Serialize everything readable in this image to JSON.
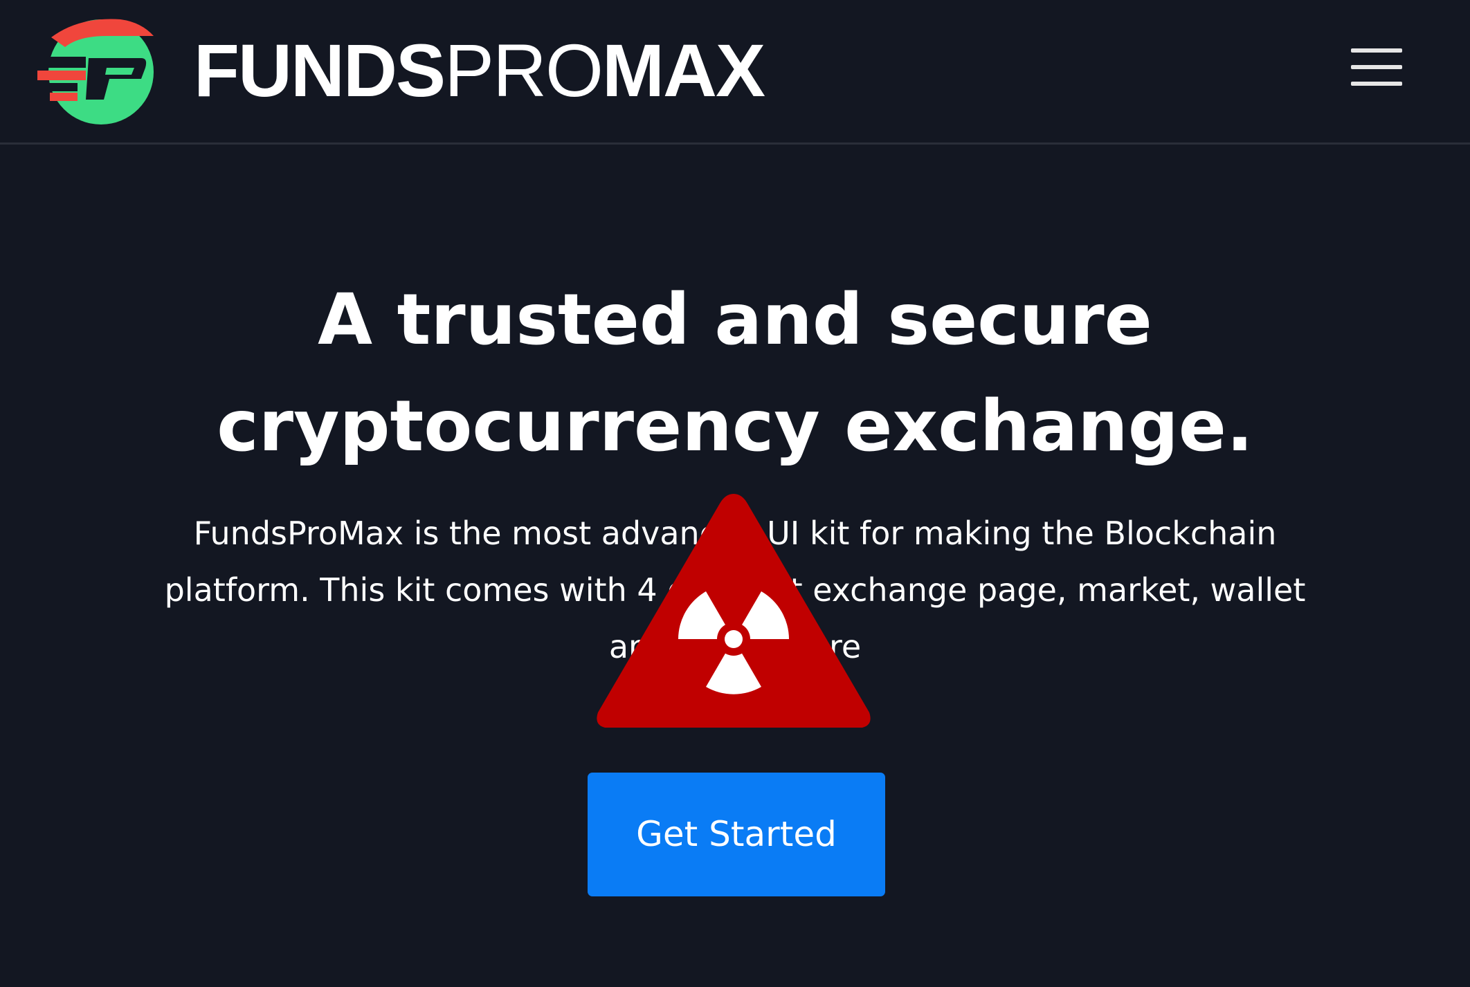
{
  "header": {
    "brand_bold_1": "FUNDS",
    "brand_light": "PRO",
    "brand_bold_2": "MAX",
    "logo_icon": "fundspromax-logo-icon",
    "menu_icon": "hamburger-menu-icon"
  },
  "hero": {
    "headline_lines": [
      "A trusted and secure",
      "cryptocurrency exchange."
    ],
    "lead_lines": [
      "FundsProMax is the most advanced UI kit for making the Blockchain",
      "platform. This kit comes with 4 different exchange page, market, wallet",
      "and many more"
    ],
    "cta_label": "Get Started",
    "overlay_icon": "radiation-warning-icon"
  },
  "colors": {
    "background": "#131722",
    "accent_blue": "#0a7cf5",
    "logo_green": "#3ddc84",
    "logo_red": "#f0463c",
    "warning_red": "#c00000"
  }
}
